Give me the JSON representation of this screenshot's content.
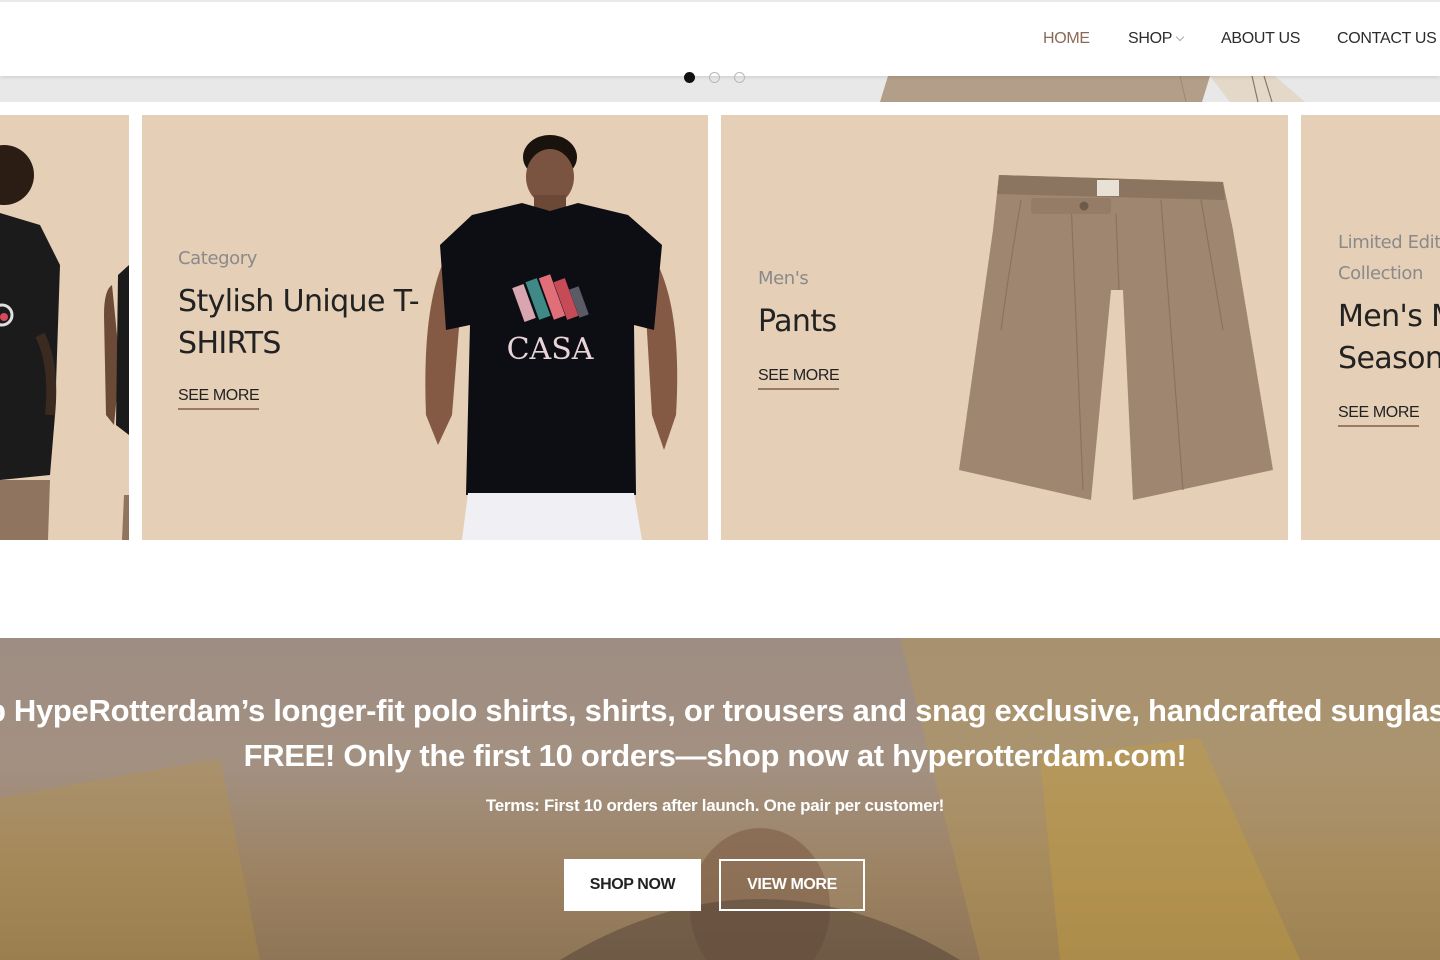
{
  "header": {
    "nav": [
      {
        "label": "HOME"
      },
      {
        "label": "SHOP"
      },
      {
        "label": "ABOUT US"
      },
      {
        "label": "CONTACT US"
      }
    ]
  },
  "hero": {
    "slide_count": 3,
    "active_slide": 1
  },
  "cards": [
    {},
    {
      "eyebrow": "Category",
      "title_line1": "Stylish Unique T-",
      "title_line2": "SHIRTS",
      "link": "SEE MORE",
      "shirt_logo": "CASA"
    },
    {
      "eyebrow": "Men's",
      "title_line1": "Pants",
      "link": "SEE MORE"
    },
    {
      "eyebrow_line1": "Limited Edit",
      "eyebrow_line2": "Collection",
      "title_line1": "Men's M",
      "title_line2": "Season",
      "link": "SEE MORE"
    }
  ],
  "promo": {
    "line1": "ab HypeRotterdam’s longer-fit polo shirts, shirts, or trousers and snag exclusive, handcrafted sunglasses",
    "line2": "FREE! Only the first 10 orders—shop now at hyperotterdam.com!",
    "terms": "Terms: First 10 orders after launch. One pair per customer!",
    "buttons": {
      "shop_now": "SHOP NOW",
      "view_more": "VIEW MORE"
    }
  },
  "colors": {
    "card_bg": "#e5cfb6",
    "nav_active": "#8a6a55",
    "link_underline": "#9a7a66"
  }
}
